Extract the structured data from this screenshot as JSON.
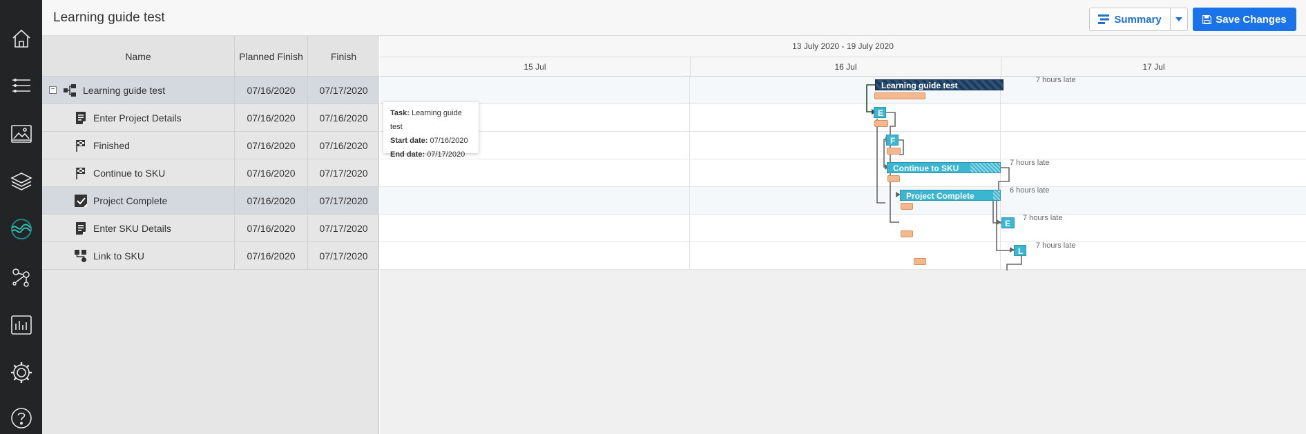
{
  "header": {
    "title": "Learning guide test",
    "summary_label": "Summary",
    "save_label": "Save Changes"
  },
  "grid": {
    "columns": {
      "name": "Name",
      "planned_finish": "Planned Finish",
      "finish": "Finish"
    },
    "rows": [
      {
        "name": "Learning guide test",
        "planned_finish": "07/16/2020",
        "finish": "07/17/2020",
        "icon": "project-tree-icon"
      },
      {
        "name": "Enter Project Details",
        "planned_finish": "07/16/2020",
        "finish": "07/16/2020",
        "icon": "form-icon"
      },
      {
        "name": "Finished",
        "planned_finish": "07/16/2020",
        "finish": "07/16/2020",
        "icon": "flag-icon"
      },
      {
        "name": "Continue to SKU",
        "planned_finish": "07/16/2020",
        "finish": "07/17/2020",
        "icon": "flag-icon"
      },
      {
        "name": "Project Complete",
        "planned_finish": "07/16/2020",
        "finish": "07/17/2020",
        "icon": "checkbox-icon"
      },
      {
        "name": "Enter SKU Details",
        "planned_finish": "07/16/2020",
        "finish": "07/17/2020",
        "icon": "form-icon"
      },
      {
        "name": "Link to SKU",
        "planned_finish": "07/16/2020",
        "finish": "07/17/2020",
        "icon": "link-icon"
      }
    ]
  },
  "timeline": {
    "range": "13 July 2020 - 19 July 2020",
    "days": [
      "15 Jul",
      "16 Jul",
      "17 Jul"
    ],
    "bars": [
      {
        "label": "Learning guide test",
        "late": "7 hours late"
      },
      {
        "label": "E",
        "late": ""
      },
      {
        "label": "F",
        "late": ""
      },
      {
        "label": "Continue to SKU",
        "late": "7 hours late"
      },
      {
        "label": "Project Complete",
        "late": "6 hours late"
      },
      {
        "label": "E",
        "late": "7 hours late"
      },
      {
        "label": "L",
        "late": "7 hours late"
      }
    ]
  },
  "tooltip": {
    "task_label": "Task:",
    "task_value": "Learning guide test",
    "start_label": "Start date:",
    "start_value": "07/16/2020",
    "end_label": "End date:",
    "end_value": "07/17/2020"
  },
  "colors": {
    "accent": "#1a73e8",
    "sidebar": "#222426",
    "summary_bar": "#1d3a5a",
    "task_bar": "#3bb6d0",
    "baseline": "#f4b88f"
  },
  "sidebar_icons": [
    "home-icon",
    "list-icon",
    "image-icon",
    "layers-icon",
    "wave-logo-icon",
    "network-icon",
    "chart-icon",
    "gear-icon",
    "help-icon"
  ]
}
